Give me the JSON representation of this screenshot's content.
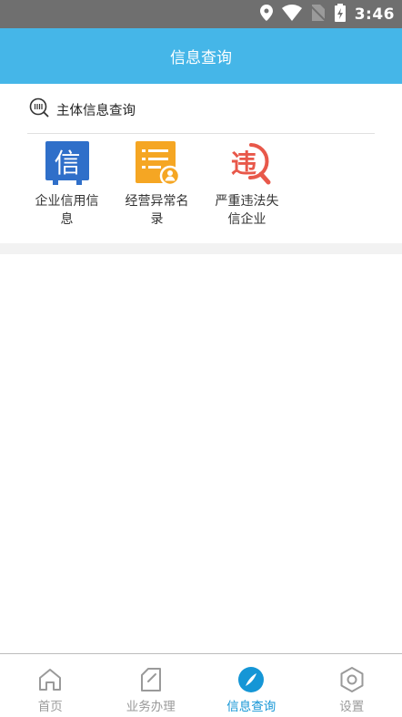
{
  "status_bar": {
    "time": "3:46",
    "icons": [
      "location-icon",
      "wifi-icon",
      "no-sim-icon",
      "battery-charging-icon"
    ]
  },
  "header": {
    "title": "信息查询"
  },
  "section": {
    "icon": "search-list-icon",
    "title": "主体信息查询",
    "items": [
      {
        "label": "企业信用信息",
        "icon": "credit-info-icon",
        "glyph": "信",
        "color": "#2f6fc9"
      },
      {
        "label": "经营异常名录",
        "icon": "abnormal-list-icon",
        "color": "#f5a623"
      },
      {
        "label": "严重违法失信企业",
        "icon": "violation-icon",
        "glyph": "违",
        "color": "#e8584a"
      }
    ]
  },
  "tabbar": {
    "active": 2,
    "tabs": [
      {
        "label": "首页",
        "icon": "home-icon"
      },
      {
        "label": "业务办理",
        "icon": "document-icon"
      },
      {
        "label": "信息查询",
        "icon": "compass-icon"
      },
      {
        "label": "设置",
        "icon": "settings-icon"
      }
    ]
  }
}
